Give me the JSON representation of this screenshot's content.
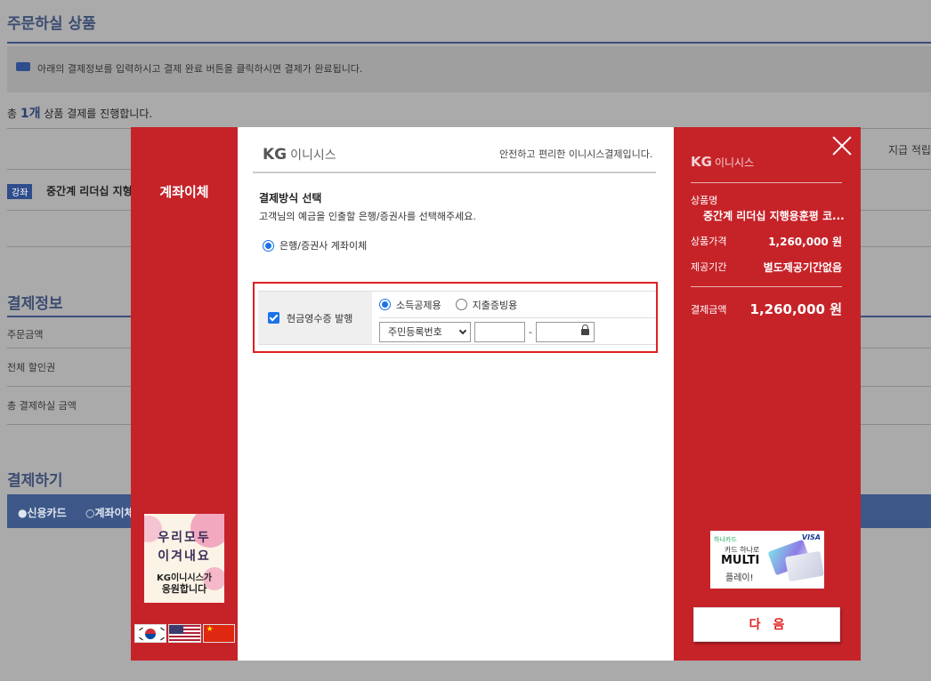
{
  "background": {
    "title": "주문하실 상품",
    "notice": "아래의 결제정보를 입력하시고 결제 완료 버튼을 클릭하시면 결제가 완료됩니다.",
    "count_prefix": "총",
    "count_value": "1개",
    "count_suffix": "상품 결제를 진행합니다.",
    "table_header_right": "지급 적립",
    "product_badge": "강좌",
    "product_name": "중간계 리더십 지형",
    "payinfo_title": "결제정보",
    "rows": [
      "주문금액",
      "전체 할인권",
      "총 결제하실 금액"
    ],
    "pay_title": "결제하기",
    "pay_opt1": "●신용카드",
    "pay_opt2": "○계좌이체"
  },
  "modal": {
    "left": {
      "tab_label": "계좌이체",
      "promo": {
        "line1": "우리모두",
        "line2": "이겨내요",
        "line3": "KG이니시스가",
        "line4": "응원합니다"
      }
    },
    "center": {
      "logo": "KG",
      "logo_sub": "이니시스",
      "tagline": "안전하고 편리한 이니시스결제입니다.",
      "section_title": "결제방식 선택",
      "section_sub": "고객님의 예금을 인출할 은행/증권사를 선택해주세요.",
      "bank_option": "은행/증권사 계좌이체",
      "receipt": {
        "checkbox_label": "현금영수증 발행",
        "opt_income": "소득공제용",
        "opt_expense": "지출증빙용",
        "id_type": "주민등록번호",
        "separator": "-"
      }
    },
    "right": {
      "logo": "KG",
      "logo_sub": "이니시스",
      "product_label": "상품명",
      "product_value": "중간계 리더십 지행용훈평 코...",
      "price_label": "상품가격",
      "price_value": "1,260,000 원",
      "period_label": "제공기간",
      "period_value": "별도제공기간없음",
      "amount_label": "결제금액",
      "amount_value": "1,260,000 원",
      "card_ad": {
        "brand": "하나카드",
        "visa": "VISA",
        "line1": "카드 하나로",
        "line2": "MULTI",
        "line3": "플레이!"
      },
      "next_button": "다음"
    }
  }
}
